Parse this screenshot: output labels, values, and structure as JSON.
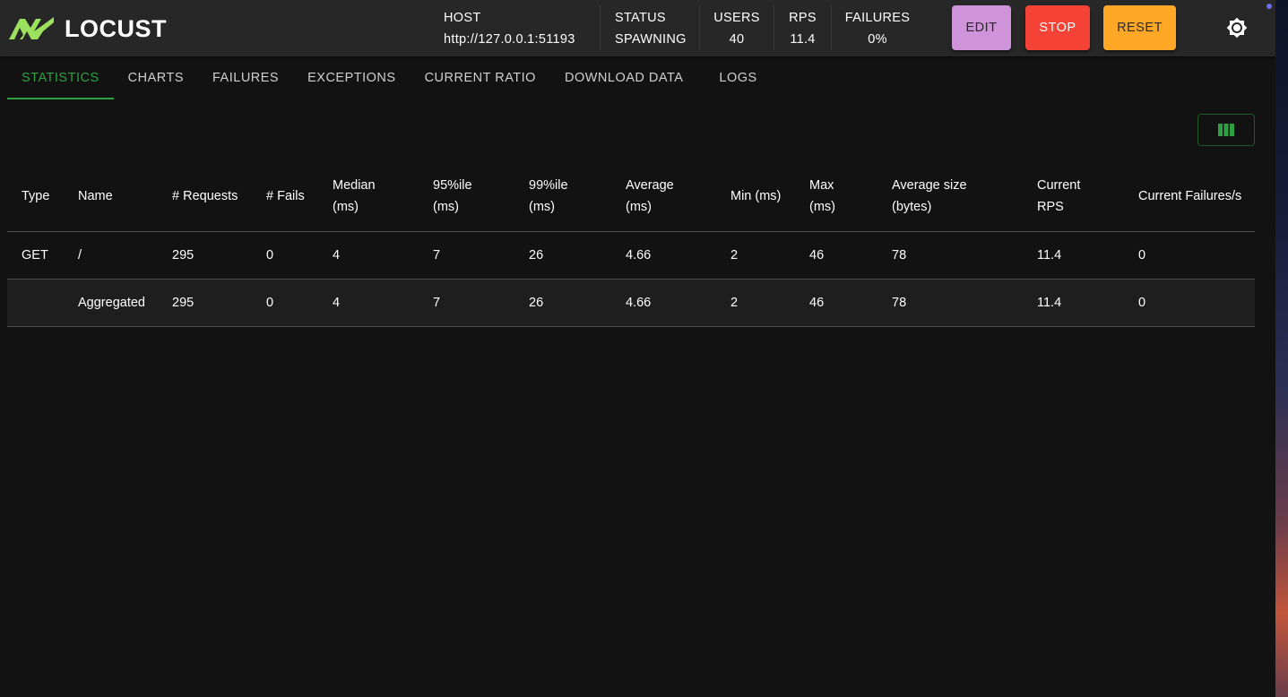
{
  "header": {
    "logo_text": "LOCUST",
    "stats": {
      "host": {
        "label": "HOST",
        "value": "http://127.0.0.1:51193"
      },
      "status": {
        "label": "STATUS",
        "value": "SPAWNING"
      },
      "users": {
        "label": "USERS",
        "value": "40"
      },
      "rps": {
        "label": "RPS",
        "value": "11.4"
      },
      "failures": {
        "label": "FAILURES",
        "value": "0%"
      }
    },
    "buttons": {
      "edit": "EDIT",
      "stop": "STOP",
      "reset": "RESET"
    },
    "colors": {
      "bar": "#272727",
      "edit": "#ce93d8",
      "stop": "#f44336",
      "reset": "#ffa726",
      "accent": "#2ea043"
    },
    "theme_icon": "brightness-icon"
  },
  "tabs": [
    "STATISTICS",
    "CHARTS",
    "FAILURES",
    "EXCEPTIONS",
    "CURRENT RATIO",
    "DOWNLOAD DATA",
    "LOGS"
  ],
  "active_tab": "STATISTICS",
  "toolbar": {
    "columns_icon": "view-column-icon"
  },
  "table": {
    "headers": {
      "type": "Type",
      "name": "Name",
      "requests": "# Requests",
      "fails": "# Fails",
      "median_1": "Median",
      "median_2": "(ms)",
      "p95_1": "95%ile",
      "p95_2": "(ms)",
      "p99_1": "99%ile",
      "p99_2": "(ms)",
      "avg_1": "Average",
      "avg_2": "(ms)",
      "min": "Min (ms)",
      "max_1": "Max",
      "max_2": "(ms)",
      "size_1": "Average size",
      "size_2": "(bytes)",
      "rps_1": "Current",
      "rps_2": "RPS",
      "cur_fail": "Current Failures/s"
    },
    "rows": [
      {
        "type": "GET",
        "name": "/",
        "requests": "295",
        "fails": "0",
        "median": "4",
        "p95": "7",
        "p99": "26",
        "avg": "4.66",
        "min": "2",
        "max": "46",
        "size": "78",
        "rps": "11.4",
        "cur_fail": "0"
      },
      {
        "type": "",
        "name": "Aggregated",
        "requests": "295",
        "fails": "0",
        "median": "4",
        "p95": "7",
        "p99": "26",
        "avg": "4.66",
        "min": "2",
        "max": "46",
        "size": "78",
        "rps": "11.4",
        "cur_fail": "0"
      }
    ]
  }
}
